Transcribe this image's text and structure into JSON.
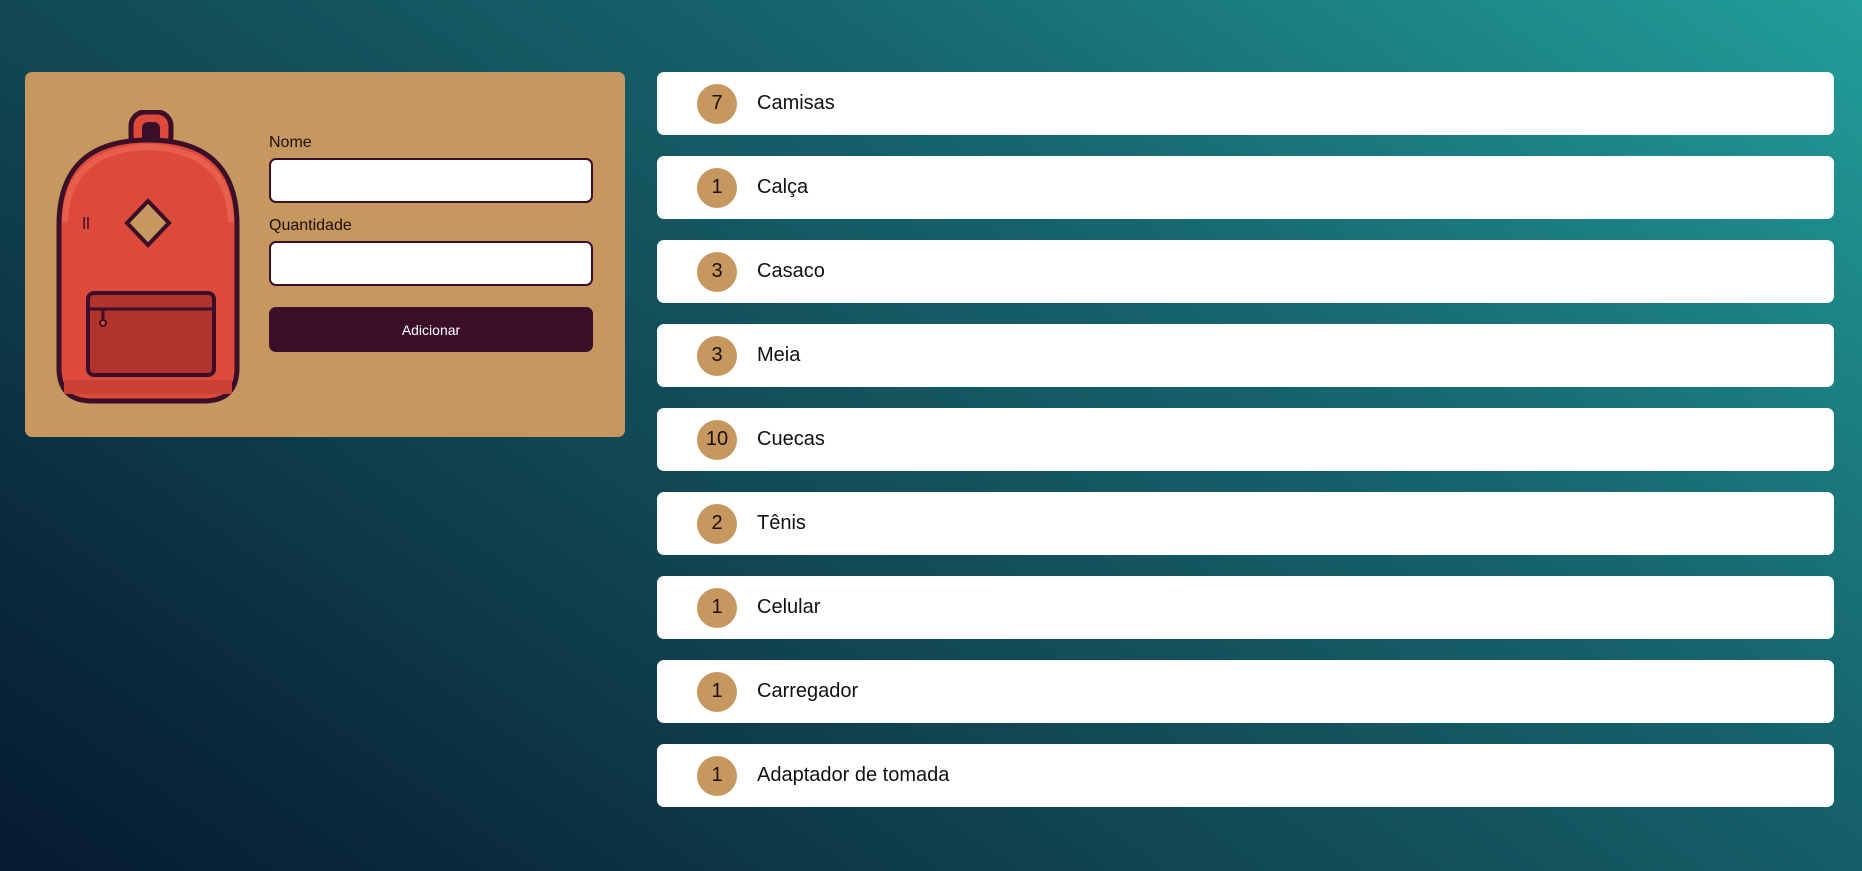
{
  "form": {
    "name_label": "Nome",
    "name_value": "",
    "quantity_label": "Quantidade",
    "quantity_value": "",
    "add_button_label": "Adicionar"
  },
  "items": [
    {
      "quantity": "7",
      "name": "Camisas"
    },
    {
      "quantity": "1",
      "name": "Calça"
    },
    {
      "quantity": "3",
      "name": "Casaco"
    },
    {
      "quantity": "3",
      "name": "Meia"
    },
    {
      "quantity": "10",
      "name": "Cuecas"
    },
    {
      "quantity": "2",
      "name": "Tênis"
    },
    {
      "quantity": "1",
      "name": "Celular"
    },
    {
      "quantity": "1",
      "name": "Carregador"
    },
    {
      "quantity": "1",
      "name": "Adaptador de tomada"
    }
  ],
  "icons": {
    "illustration": "backpack-icon"
  },
  "colors": {
    "card_background": "#c6975f",
    "accent_dark": "#3b0f2a",
    "backpack_red": "#dd4a3a",
    "badge": "#c6975f"
  }
}
